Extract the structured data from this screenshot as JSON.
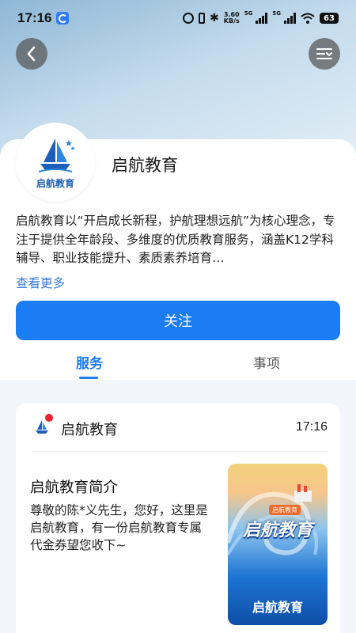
{
  "status_bar": {
    "time": "17:16",
    "network_speed_value": "3.60",
    "network_speed_unit": "KB/s",
    "signal_label_1": "5G",
    "signal_label_2": "5G",
    "battery": "63"
  },
  "header": {
    "back_icon": "chevron-left-icon",
    "menu_icon": "filter-menu-icon"
  },
  "profile": {
    "logo_text": "启航教育",
    "name": "启航教育",
    "description": "启航教育以“开启成长新程，护航理想远航”为核心理念，专注于提供全年龄段、多维度的优质教育服务，涵盖K12学科辅导、职业技能提升、素质素养培育…",
    "more_link": "查看更多",
    "follow_label": "关注"
  },
  "tabs": [
    {
      "label": "服务",
      "active": true
    },
    {
      "label": "事项",
      "active": false
    }
  ],
  "message": {
    "sender": "启航教育",
    "time": "17:16",
    "title": "启航教育简介",
    "body": "尊敬的陈*义先生，您好，这里是启航教育，有一份启航教育专属代金券望您收下~",
    "poster_tag": "启航教育",
    "poster_title": "启航教育",
    "poster_bottom": "启航教育"
  },
  "colors": {
    "accent": "#1a7df4",
    "link": "#3a7bd5",
    "notification_dot": "#e8232f"
  }
}
